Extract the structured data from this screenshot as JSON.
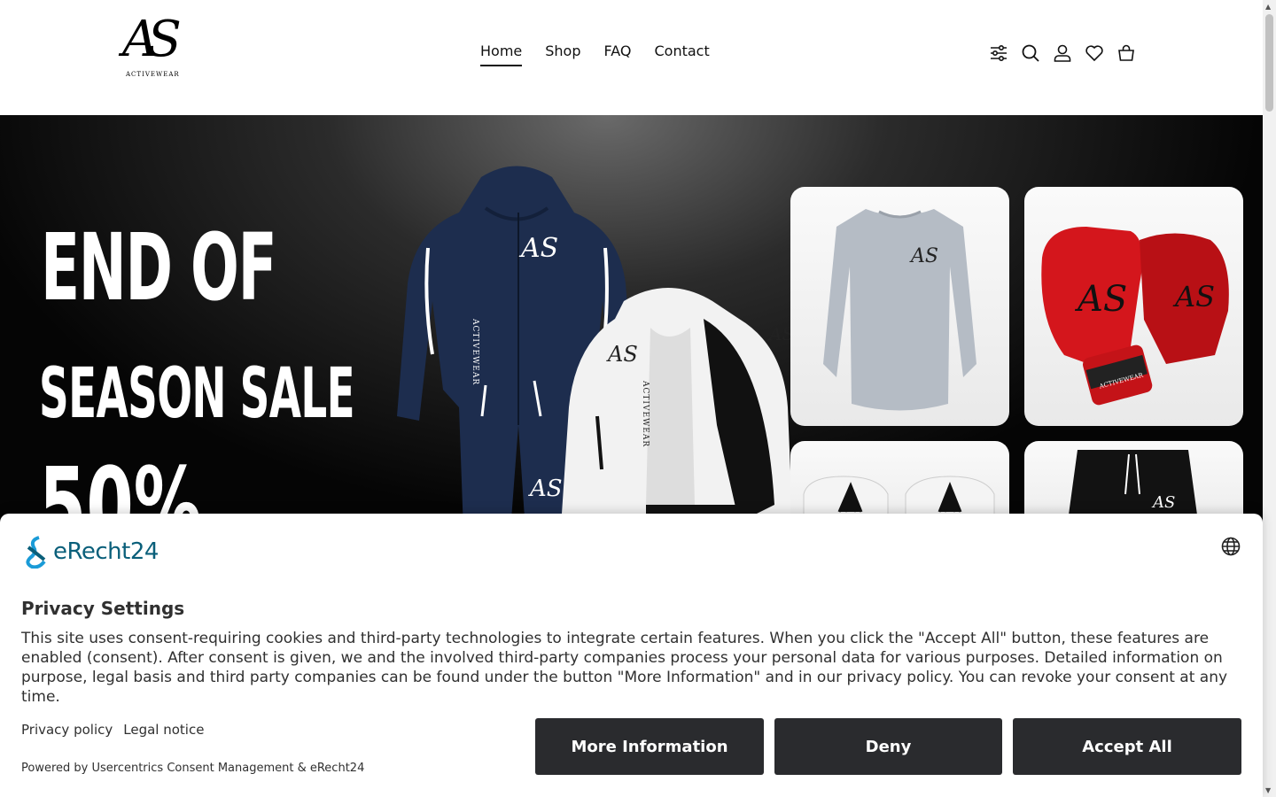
{
  "logo": {
    "monogram": "AS",
    "subtitle": "ACTIVEWEAR"
  },
  "nav": {
    "items": [
      {
        "label": "Home",
        "active": true
      },
      {
        "label": "Shop",
        "active": false
      },
      {
        "label": "FAQ",
        "active": false
      },
      {
        "label": "Contact",
        "active": false
      }
    ]
  },
  "header_icons": [
    "filter-icon",
    "search-icon",
    "account-icon",
    "wishlist-icon",
    "cart-icon"
  ],
  "hero": {
    "line1": "END OF",
    "line2": "SEASON SALE",
    "line3": "50%",
    "product_logo": "AS",
    "product_brand": "ACTIVEWEAR"
  },
  "consent": {
    "brand": "eRecht24",
    "title": "Privacy Settings",
    "description": "This site uses consent-requiring cookies and third-party technologies to integrate certain features. When you click the \"Accept All\" button, these features are enabled (consent). After consent is given, we and the involved third-party companies process your personal data for various purposes. Detailed information on purpose, legal basis and third party companies can be found under the button \"More Information\" and in our privacy policy. You can revoke your consent at any time.",
    "privacy_policy": "Privacy policy",
    "legal_notice": "Legal notice",
    "powered_by": "Powered by Usercentrics Consent Management & eRecht24",
    "more_info": "More Information",
    "deny": "Deny",
    "accept_all": "Accept All"
  },
  "colors": {
    "button_bg": "#2a2b2e",
    "brand": "#0a5f7a",
    "hero_bg": "#050505",
    "glove_red": "#d4161c"
  }
}
